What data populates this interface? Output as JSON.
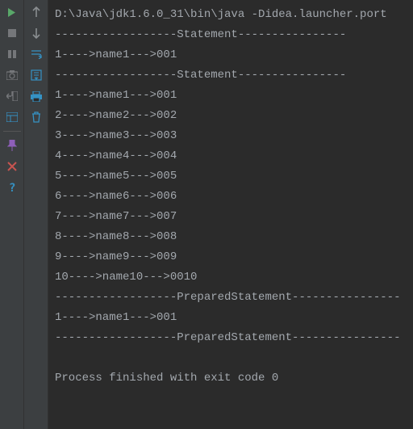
{
  "gutter1": {
    "run": "run-icon",
    "stop": "stop-icon",
    "pause": "pause-icon",
    "camera": "camera-icon",
    "exit": "exit-icon",
    "layout": "layout-icon",
    "divider": true,
    "pin": "pin-icon",
    "close": "close-icon",
    "help": "help-icon"
  },
  "gutter2": {
    "up": "arrow-up-icon",
    "down": "arrow-down-icon",
    "wrap": "soft-wrap-icon",
    "scroll": "scroll-end-icon",
    "print": "print-icon",
    "clear": "clear-icon"
  },
  "console": {
    "lines": [
      "D:\\Java\\jdk1.6.0_31\\bin\\java -Didea.launcher.port",
      "------------------Statement----------------",
      "1---->name1--->001",
      "------------------Statement----------------",
      "1---->name1--->001",
      "2---->name2--->002",
      "3---->name3--->003",
      "4---->name4--->004",
      "5---->name5--->005",
      "6---->name6--->006",
      "7---->name7--->007",
      "8---->name8--->008",
      "9---->name9--->009",
      "10---->name10--->0010",
      "------------------PreparedStatement----------------",
      "1---->name1--->001",
      "------------------PreparedStatement----------------",
      "",
      "Process finished with exit code 0"
    ]
  }
}
